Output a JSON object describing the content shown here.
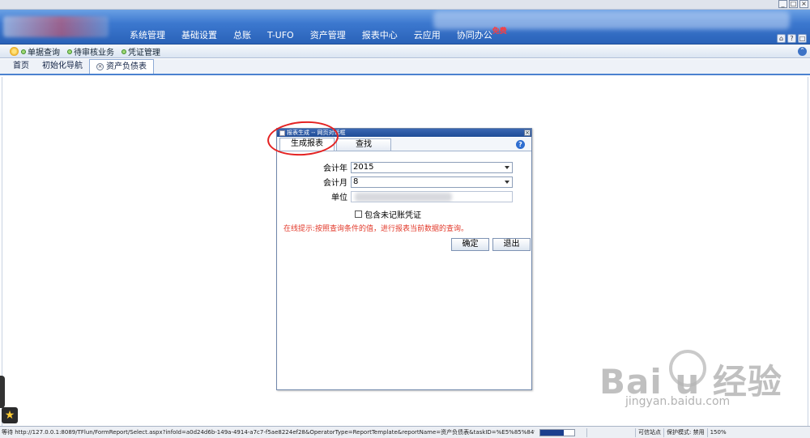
{
  "nav": {
    "items": [
      "系统管理",
      "基础设置",
      "总账",
      "T-UFO",
      "资产管理",
      "报表中心",
      "云应用",
      "协同办公"
    ],
    "badge": "免费"
  },
  "toolbar": {
    "items": [
      "单据查询",
      "待审核业务",
      "凭证管理"
    ]
  },
  "tabs": {
    "home": "首页",
    "init": "初始化导航",
    "active": "资产负债表"
  },
  "dialog": {
    "title": "报表生成 -- 网页对话框",
    "close": "×",
    "tab_generate": "生成报表",
    "tab_search": "查找",
    "help": "?",
    "year_label": "会计年",
    "year_value": "2015",
    "month_label": "会计月",
    "month_value": "8",
    "unit_label": "单位",
    "include_label": "包含未记账凭证",
    "hint": "在线提示:按照查询条件的值，进行报表当前数据的查询。",
    "ok": "确定",
    "exit": "退出"
  },
  "window": {
    "min": "_",
    "max": "□",
    "close": "×"
  },
  "header_icons": [
    "⌂",
    "?",
    "□"
  ],
  "watermark": {
    "brand": "Bai  u 经验",
    "url": "jingyan.baidu.com"
  },
  "status": {
    "text": "等待 http://127.0.0.1:8089/TFlun/FormReport/Select.aspx?infoId=a0d24d6b-149a-4914-a7c7-f5ae8224ef28&OperatorType=ReportTemplate&reportName=资产负债表&taskID=%E5%85%84%E4%BA%A7%E8%B4%9F%E5%80%BA%E8%A1%A8...",
    "progress": 0.7,
    "zone": "可信站点",
    "protected": "保护模式: 禁用",
    "zoom": "150%"
  },
  "colors": {
    "header": "#2a62b8",
    "hint": "#e23a2b",
    "annotation": "#e42222"
  }
}
